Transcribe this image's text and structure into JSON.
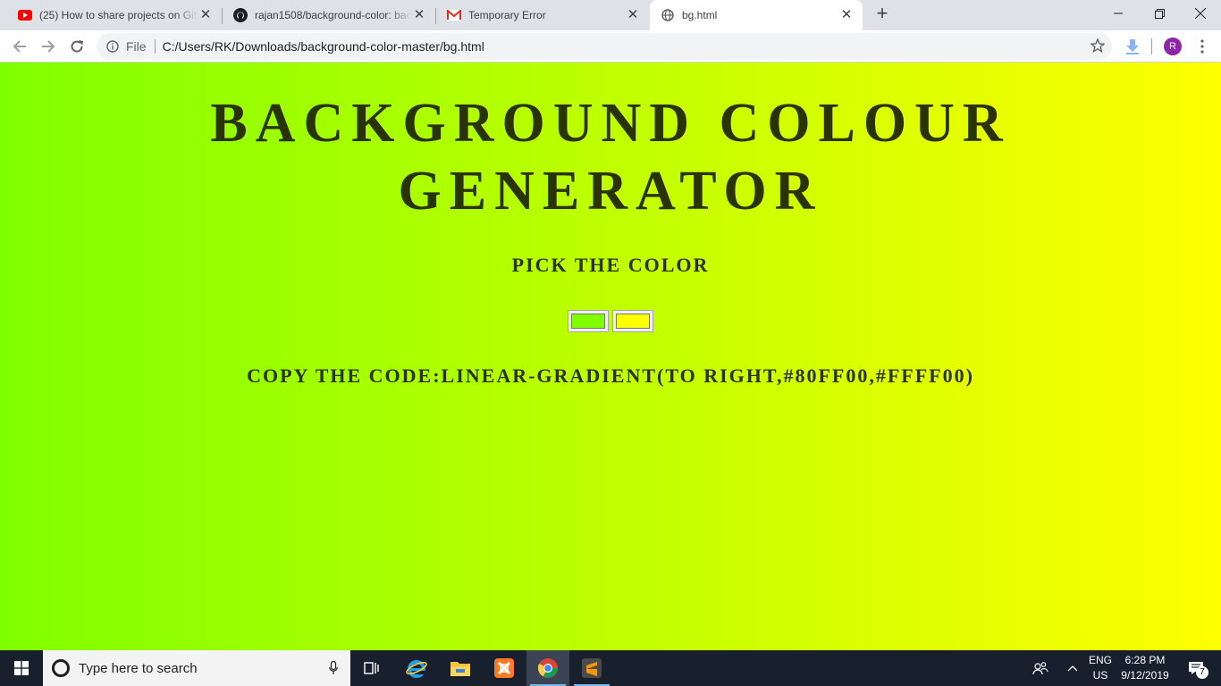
{
  "tabs": [
    {
      "title": "(25) How to share projects on Git",
      "icon": "youtube-icon"
    },
    {
      "title": "rajan1508/background-color: bac",
      "icon": "github-icon"
    },
    {
      "title": "Temporary Error",
      "icon": "gmail-icon"
    },
    {
      "title": "bg.html",
      "icon": "globe-icon",
      "active": true
    }
  ],
  "toolbar": {
    "scheme": "File",
    "url": "C:/Users/RK/Downloads/background-color-master/bg.html",
    "profile_initial": "R"
  },
  "page": {
    "heading_line1": "BACKGROUND COLOUR",
    "heading_line2": "GENERATOR",
    "subheading": "PICK THE COLOR",
    "color1": "#80ff00",
    "color2": "#ffff00",
    "code_text": "COPY THE CODE:LINEAR-GRADIENT(TO RIGHT,#80FF00,#FFFF00)"
  },
  "taskbar": {
    "search_placeholder": "Type here to search",
    "language_line1": "ENG",
    "language_line2": "US",
    "time": "6:28 PM",
    "date": "9/12/2019",
    "notification_count": "7"
  }
}
